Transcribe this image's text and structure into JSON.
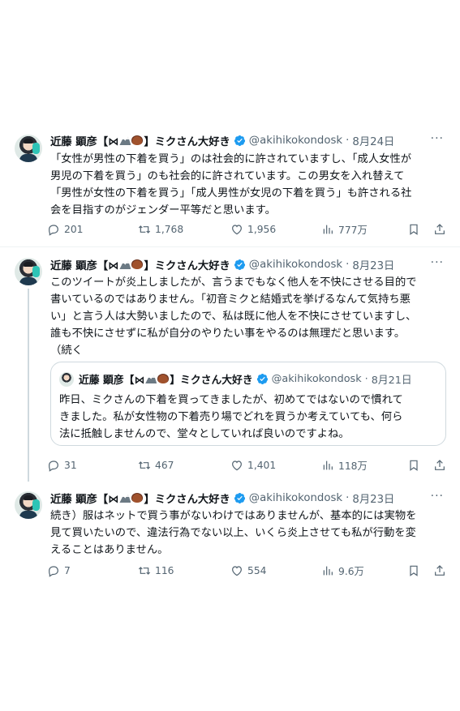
{
  "tweets": [
    {
      "name": "近藤 顕彦【⋈",
      "name_suffix": "】ミクさん大好き",
      "handle": "@akihikokondosk",
      "date": "8月24日",
      "lines": [
        "「女性が男性の下着を買う」のは社会的に許されていますし、「成人女性が",
        "男児の下着を買う」のも社会的に許されています。この男女を入れ替えて",
        "「男性が女性の下着を買う」「成人男性が女児の下着を買う」も許される社",
        "会を目指すのがジェンダー平等だと思います。"
      ],
      "replies": "201",
      "retweets": "1,768",
      "likes": "1,956",
      "views": "777万"
    },
    {
      "name": "近藤 顕彦【⋈",
      "name_suffix": "】ミクさん大好き",
      "handle": "@akihikokondosk",
      "date": "8月23日",
      "lines": [
        "このツイートが炎上しましたが、言うまでもなく他人を不快にさせる目的で",
        "書いているのではありません。「初音ミクと結婚式を挙げるなんて気持ち悪",
        "い」と言う人は大勢いましたので、私は既に他人を不快にさせていますし、",
        "誰も不快にさせずに私が自分のやりたい事をやるのは無理だと思います。",
        "（続く"
      ],
      "quote": {
        "name": "近藤 顕彦【⋈",
        "name_suffix": "】ミクさん大好き",
        "handle": "@akihikokondosk",
        "date": "8月21日",
        "lines": [
          "昨日、ミクさんの下着を買ってきましたが、初めてではないので慣れて",
          "きました。私が女性物の下着売り場でどれを買うか考えていても、何ら",
          "法に抵触しませんので、堂々としていれば良いのですよね。"
        ]
      },
      "replies": "31",
      "retweets": "467",
      "likes": "1,401",
      "views": "118万"
    },
    {
      "name": "近藤 顕彦【⋈",
      "name_suffix": "】ミクさん大好き",
      "handle": "@akihikokondosk",
      "date": "8月23日",
      "lines": [
        "続き）服はネットで買う事がないわけではありませんが、基本的には実物を",
        "見て買いたいので、違法行為でない以上、いくら炎上させても私が行動を変",
        "えることはありません。"
      ],
      "replies": "7",
      "retweets": "116",
      "likes": "554",
      "views": "9.6万"
    }
  ],
  "colors": {
    "verified": "#1d9bf0",
    "muted": "#536471",
    "text": "#0f1419",
    "border": "#cfd9de"
  },
  "icons": [
    "reply-icon",
    "retweet-icon",
    "like-icon",
    "views-icon",
    "bookmark-icon",
    "share-icon",
    "verified-icon",
    "more-icon"
  ]
}
